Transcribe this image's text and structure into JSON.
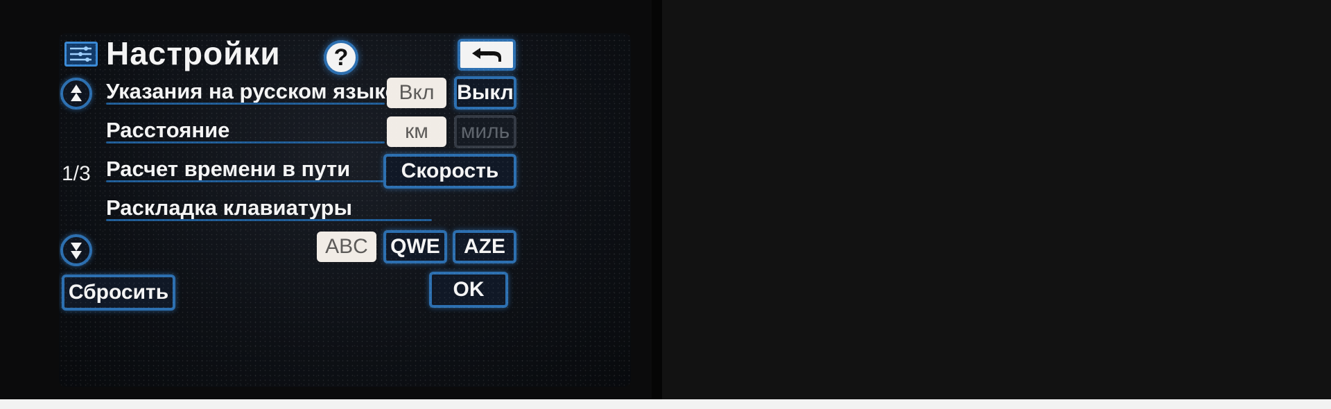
{
  "screen": {
    "title": "Настройки",
    "page_indicator": "1/3",
    "icons": {
      "menu": "settings-list-icon",
      "help": "question-mark-icon",
      "back": "return-arrow-icon",
      "scroll_up": "scroll-up-arrow-icon",
      "scroll_down": "scroll-down-arrow-icon"
    },
    "help_label": "?",
    "rows": {
      "russian_guidance": {
        "label": "Указания на русском языке",
        "on": "Вкл",
        "off": "Выкл"
      },
      "distance": {
        "label": "Расстояние",
        "km": "км",
        "miles": "миль"
      },
      "travel_time": {
        "label": "Расчет времени в пути",
        "value": "Скорость"
      },
      "keyboard": {
        "label": "Раскладка клавиатуры",
        "options": [
          "ABC",
          "QWE",
          "AZE"
        ]
      }
    },
    "reset_label": "Сбросить",
    "ok_label": "OK"
  },
  "colors": {
    "accent_left": "#2c6fb0",
    "accent_right": "#d9c9b2",
    "selected": "#f1ece6",
    "text": "#f4f4f4"
  }
}
